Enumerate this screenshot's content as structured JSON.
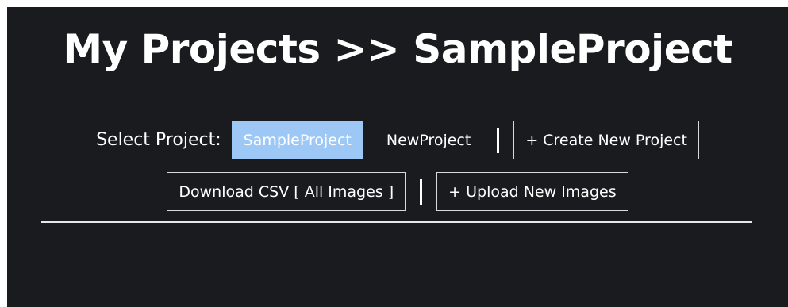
{
  "header": {
    "title": "My Projects >> SampleProject"
  },
  "project_selector": {
    "label": "Select Project:",
    "projects": [
      "SampleProject",
      "NewProject"
    ],
    "selected": "SampleProject",
    "separator": "|",
    "create_label": "+ Create New Project"
  },
  "actions": {
    "download_label": "Download CSV [ All Images ]",
    "separator": "|",
    "upload_label": "+ Upload New Images"
  },
  "colors": {
    "background": "#191b1e",
    "selected_button": "#9dc8f5",
    "text": "#ffffff"
  }
}
